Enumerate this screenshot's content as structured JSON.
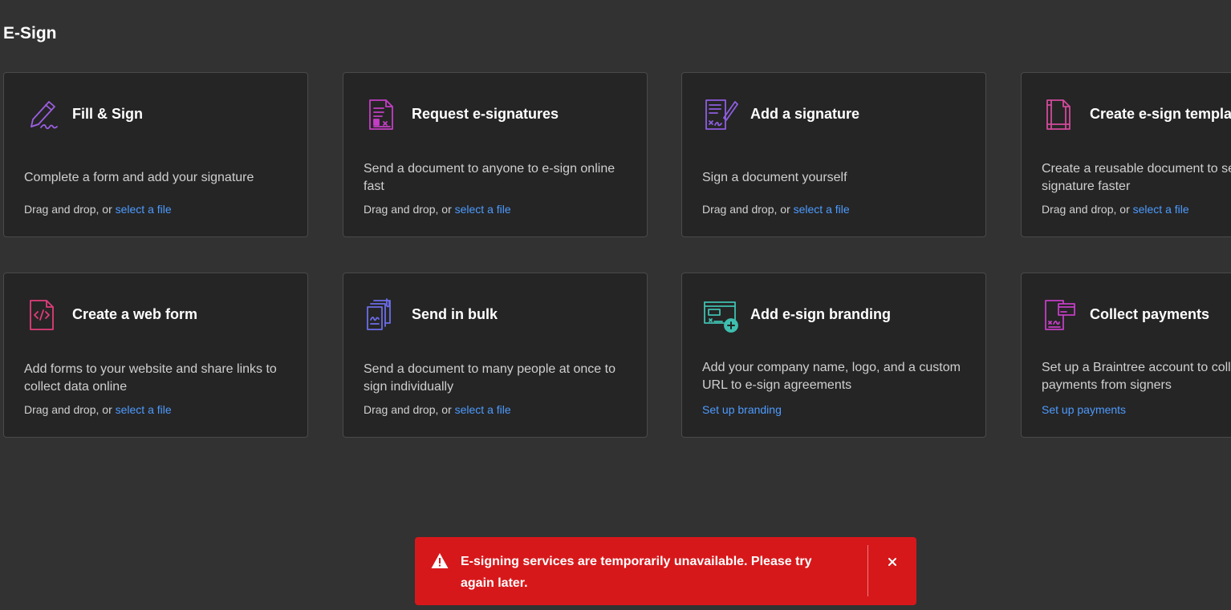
{
  "page": {
    "title": "E-Sign"
  },
  "cards": [
    {
      "title": "Fill & Sign",
      "icon": "fill-sign-icon",
      "description": "Complete a form and add your signature",
      "action_prefix": "Drag and drop, or ",
      "action_link": "select a file"
    },
    {
      "title": "Request e-signatures",
      "icon": "request-signatures-icon",
      "description": "Send a document to anyone to e-sign online fast",
      "action_prefix": "Drag and drop, or ",
      "action_link": "select a file"
    },
    {
      "title": "Add a signature",
      "icon": "add-signature-icon",
      "description": "Sign a document yourself",
      "action_prefix": "Drag and drop, or ",
      "action_link": "select a file"
    },
    {
      "title": "Create e-sign template",
      "icon": "template-icon",
      "description": "Create a reusable document to send for signature faster",
      "action_prefix": "Drag and drop, or ",
      "action_link": "select a file"
    },
    {
      "title": "Create a web form",
      "icon": "web-form-icon",
      "description": "Add forms to your website and share links to collect data online",
      "action_prefix": "Drag and drop, or ",
      "action_link": "select a file"
    },
    {
      "title": "Send in bulk",
      "icon": "send-bulk-icon",
      "description": "Send a document to many people at once to sign individually",
      "action_prefix": "Drag and drop, or ",
      "action_link": "select a file"
    },
    {
      "title": "Add e-sign branding",
      "icon": "branding-icon",
      "description": "Add your company name, logo, and a custom URL to e-sign agreements",
      "action_prefix": "",
      "action_link": "Set up branding"
    },
    {
      "title": "Collect payments",
      "icon": "payments-icon",
      "description": "Set up a Braintree account to collect payments from signers",
      "action_prefix": "",
      "action_link": "Set up payments"
    }
  ],
  "toast": {
    "message": "E-signing services are temporarily unavailable. Please try again later.",
    "icon": "warning-icon",
    "close_icon": "close-icon",
    "color": "#d7181b"
  },
  "colors": {
    "background": "#323232",
    "card": "#252525",
    "link": "#4d9bff",
    "accent_purple": "#9b59d6",
    "accent_teal": "#3fbfb0"
  }
}
